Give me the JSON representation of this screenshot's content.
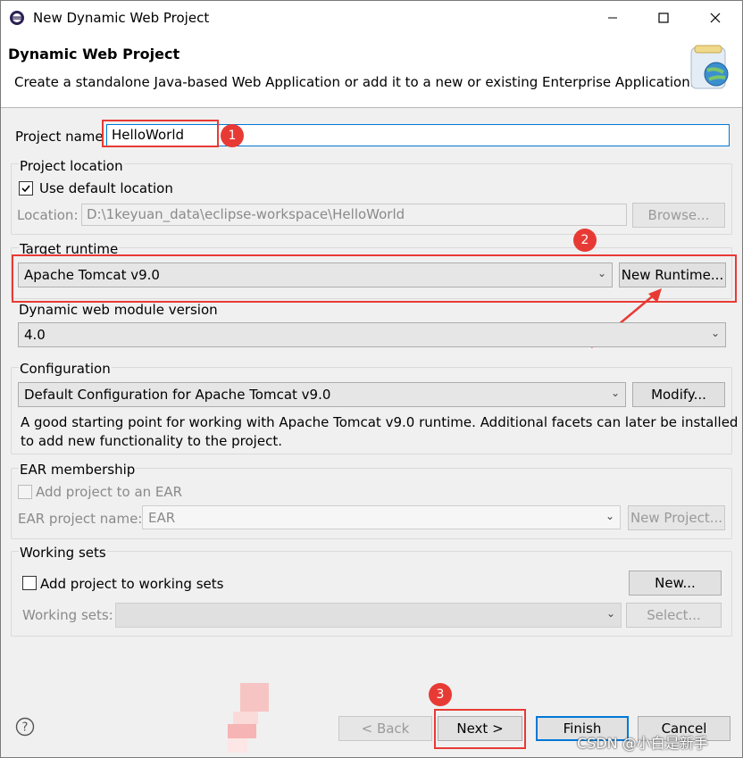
{
  "window": {
    "title": "New Dynamic Web Project",
    "controls": [
      "minimize-icon",
      "maximize-icon",
      "close-icon"
    ]
  },
  "banner": {
    "title": "Dynamic Web Project",
    "description": "Create a standalone Java-based Web Application or add it to a new or existing Enterprise Application."
  },
  "project_name": {
    "label": "Project name",
    "value": "HelloWorld"
  },
  "project_location": {
    "group_label": "Project location",
    "use_default_label": "Use default location",
    "use_default_checked": true,
    "location_label": "Location:",
    "location_value": "D:\\1keyuan_data\\eclipse-workspace\\HelloWorld",
    "browse_label": "Browse..."
  },
  "target_runtime": {
    "group_label": "Target runtime",
    "selected": "Apache Tomcat v9.0",
    "new_runtime_label": "New Runtime..."
  },
  "module_version": {
    "label": "Dynamic web module version",
    "selected": "4.0"
  },
  "configuration": {
    "group_label": "Configuration",
    "selected": "Default Configuration for Apache Tomcat v9.0",
    "modify_label": "Modify...",
    "description_line1": "A good starting point for working with Apache Tomcat v9.0 runtime. Additional facets can later be installed",
    "description_line2": "to add new functionality to the project."
  },
  "ear": {
    "group_label": "EAR membership",
    "add_label": "Add project to an EAR",
    "add_checked": false,
    "name_label": "EAR project name:",
    "name_value": "EAR",
    "new_project_label": "New Project..."
  },
  "working_sets": {
    "group_label": "Working sets",
    "add_label": "Add project to working sets",
    "add_checked": false,
    "new_label": "New...",
    "sets_label": "Working sets:",
    "select_label": "Select..."
  },
  "footer": {
    "help_icon": "help-icon",
    "back_label": "< Back",
    "next_label": "Next >",
    "finish_label": "Finish",
    "cancel_label": "Cancel"
  },
  "annotations": {
    "one": "1",
    "two": "2",
    "three": "3"
  },
  "watermark": "CSDN @小白是新手",
  "colors": {
    "annotation_red": "#e83a35",
    "focus_blue": "#0078d7"
  }
}
